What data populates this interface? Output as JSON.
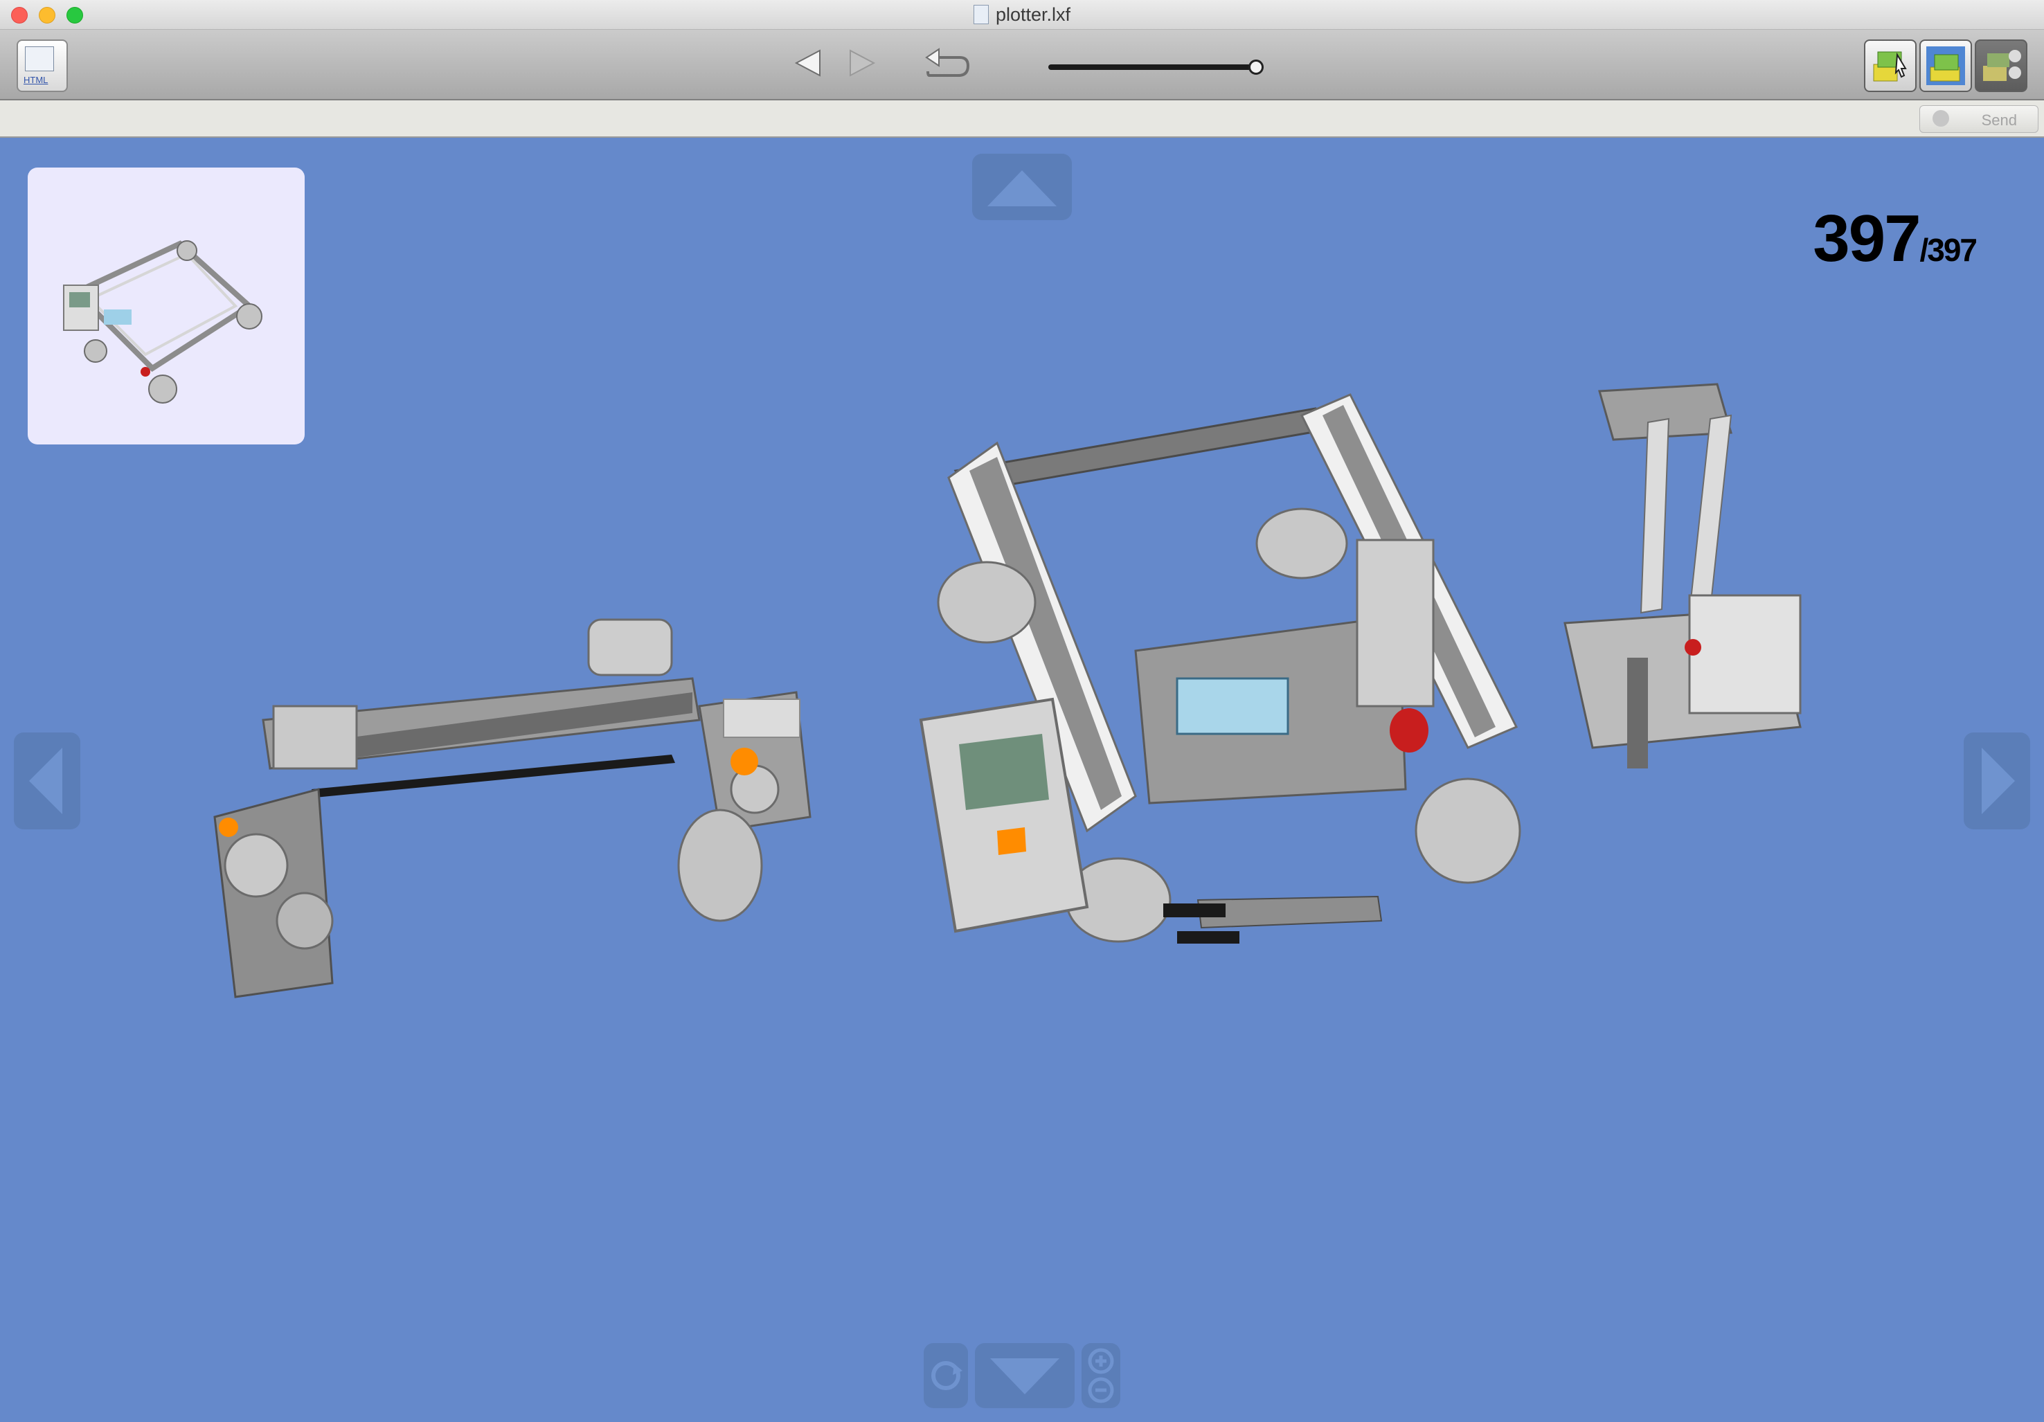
{
  "window": {
    "title": "plotter.lxf"
  },
  "toolbar": {
    "html_button_label": "HTML",
    "playback": {
      "progress": 1.0
    }
  },
  "addressbar": {
    "send_label": "Send"
  },
  "stepper": {
    "current": "397",
    "total": "/397"
  },
  "icons": {
    "html": "html-export-icon",
    "back": "triangle-left-icon",
    "forward": "triangle-right-icon",
    "undo": "undo-arrow-icon",
    "mode_build": "brick-cursor-icon",
    "mode_view": "brick-view-icon",
    "mode_steps": "brick-steps-icon"
  },
  "colors": {
    "canvas": "#6589cb",
    "toolbar": "#b8b8b8",
    "thumbnail_bg": "#ebe9fd",
    "lego_light": "#c9c9c9",
    "lego_dark": "#6b6b6b",
    "accent_orange": "#ff8c00",
    "accent_red": "#c81e1e"
  }
}
